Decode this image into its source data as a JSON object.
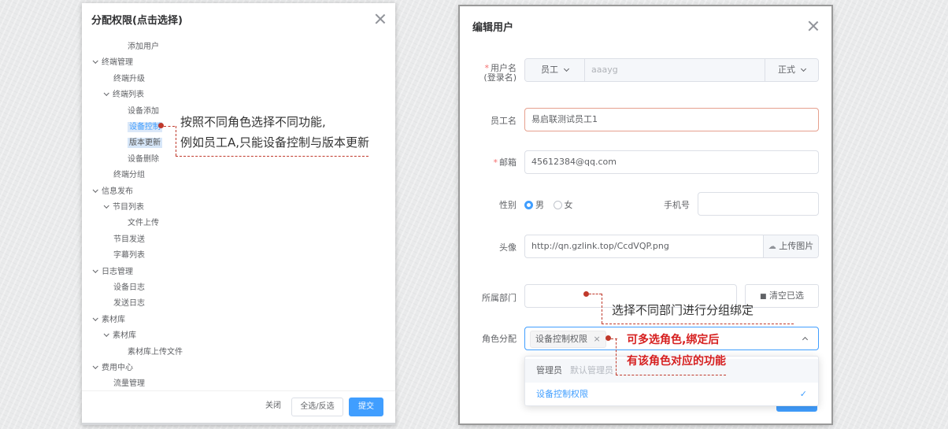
{
  "permission_dialog": {
    "title": "分配权限(点击选择)",
    "tree": [
      {
        "label": "添加用户",
        "level": 3,
        "expandable": false
      },
      {
        "label": "终端管理",
        "level": 1,
        "expandable": true
      },
      {
        "label": "终端升级",
        "level": 2,
        "expandable": false
      },
      {
        "label": "终端列表",
        "level": 2,
        "expandable": true
      },
      {
        "label": "设备添加",
        "level": 3,
        "expandable": false
      },
      {
        "label": "设备控制",
        "level": 3,
        "expandable": false,
        "selected": true
      },
      {
        "label": "版本更新",
        "level": 3,
        "expandable": false,
        "selected": true
      },
      {
        "label": "设备删除",
        "level": 3,
        "expandable": false
      },
      {
        "label": "终端分组",
        "level": 2,
        "expandable": false
      },
      {
        "label": "信息发布",
        "level": 1,
        "expandable": true
      },
      {
        "label": "节目列表",
        "level": 2,
        "expandable": true
      },
      {
        "label": "文件上传",
        "level": 3,
        "expandable": false
      },
      {
        "label": "节目发送",
        "level": 2,
        "expandable": false
      },
      {
        "label": "字幕列表",
        "level": 2,
        "expandable": false
      },
      {
        "label": "日志管理",
        "level": 1,
        "expandable": true
      },
      {
        "label": "设备日志",
        "level": 2,
        "expandable": false
      },
      {
        "label": "发送日志",
        "level": 2,
        "expandable": false
      },
      {
        "label": "素材库",
        "level": 1,
        "expandable": true
      },
      {
        "label": "素材库",
        "level": 2,
        "expandable": true
      },
      {
        "label": "素材库上传文件",
        "level": 3,
        "expandable": false
      },
      {
        "label": "费用中心",
        "level": 1,
        "expandable": true
      },
      {
        "label": "流量管理",
        "level": 2,
        "expandable": false
      }
    ],
    "footer": {
      "close_label": "关闭",
      "toggle_all_label": "全选/反选",
      "submit_label": "提交"
    },
    "annotation": {
      "line1": "按照不同角色选择不同功能,",
      "line2": "例如员工A,只能设备控制与版本更新"
    }
  },
  "edit_user_dialog": {
    "title": "编辑用户",
    "username": {
      "label_line1": "用户名",
      "label_line2": "(登录名)",
      "type_value": "员工",
      "value": "aaayg",
      "status_value": "正式"
    },
    "employee_name": {
      "label": "员工名",
      "value": "易启联测试员工1"
    },
    "email": {
      "label": "邮箱",
      "value": "45612384@qq.com"
    },
    "gender": {
      "label": "性别",
      "options": [
        "男",
        "女"
      ],
      "selected": "男"
    },
    "phone": {
      "label": "手机号",
      "value": ""
    },
    "avatar": {
      "label": "头像",
      "value": "http://qn.gzlink.top/CcdVQP.png",
      "upload_label": "上传图片"
    },
    "department": {
      "label": "所属部门",
      "value": "",
      "clear_label": "清空已选"
    },
    "role": {
      "label": "角色分配",
      "selected_tag": "设备控制权限",
      "options": [
        {
          "label": "管理员",
          "sub": "默认管理员"
        },
        {
          "label": "设备控制权限",
          "selected": true
        }
      ]
    },
    "annotations": {
      "department_note": "选择不同部门进行分组绑定",
      "role_note_line1": "可多选角色,绑定后",
      "role_note_line2": "有该角色对应的功能"
    }
  },
  "colors": {
    "primary": "#409eff",
    "annotation_red": "#d61f1f",
    "required": "#f56c6c"
  }
}
